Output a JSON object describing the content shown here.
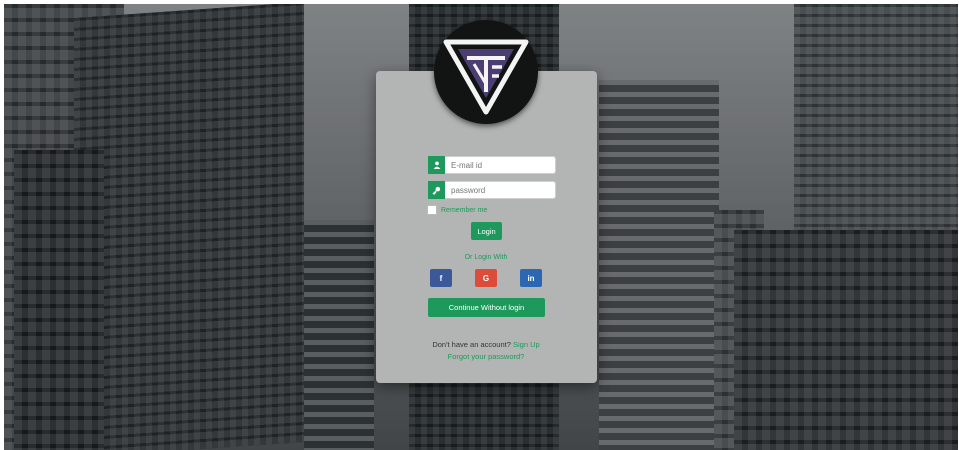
{
  "email": {
    "placeholder": "E-mail id",
    "icon": "user-icon"
  },
  "password": {
    "placeholder": "password",
    "icon": "key-icon"
  },
  "remember_label": "Remember me",
  "login_label": "Login",
  "or_login_with": "Or Login With",
  "social": {
    "facebook": "f",
    "google": "G",
    "linkedin": "in"
  },
  "continue_label": "Continue Without login",
  "account_prompt": "Don't have an account?",
  "signup_label": "Sign Up",
  "forgot_label": "Forgot your password?",
  "colors": {
    "accent": "#1d9a5b",
    "facebook": "#3b5998",
    "google": "#dd4b39",
    "linkedin": "#2c67b2",
    "card": "#b3b5b4"
  }
}
